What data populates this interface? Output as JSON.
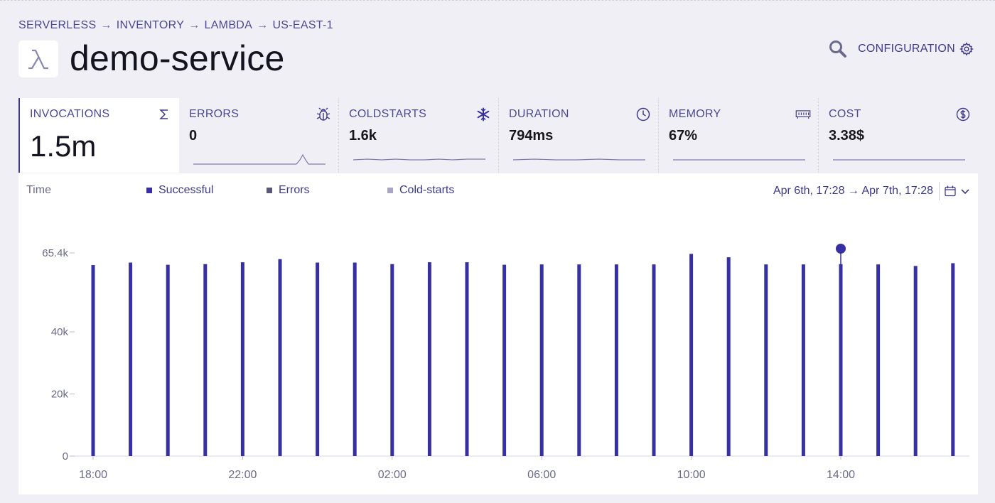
{
  "breadcrumb": [
    "SERVERLESS",
    "INVENTORY",
    "LAMBDA",
    "US-EAST-1"
  ],
  "breadcrumb_separator": "→",
  "title": "demo-service",
  "logo_icon": "lambda-icon",
  "actions": {
    "search_icon": "search-icon",
    "configuration_label": "CONFIGURATION",
    "configuration_icon": "gear-icon"
  },
  "metrics": [
    {
      "label": "INVOCATIONS",
      "value": "1.5m",
      "icon": "sigma-icon",
      "active": true
    },
    {
      "label": "ERRORS",
      "value": "0",
      "icon": "bug-icon"
    },
    {
      "label": "COLDSTARTS",
      "value": "1.6k",
      "icon": "snowflake-icon"
    },
    {
      "label": "DURATION",
      "value": "794ms",
      "icon": "clock-icon"
    },
    {
      "label": "MEMORY",
      "value": "67%",
      "icon": "memory-icon"
    },
    {
      "label": "COST",
      "value": "3.38$",
      "icon": "dollar-icon"
    }
  ],
  "legend": {
    "time_label": "Time",
    "items": [
      {
        "label": "Successful",
        "color": "#3730a3"
      },
      {
        "label": "Errors",
        "color": "#5b5a7a"
      },
      {
        "label": "Cold-starts",
        "color": "#a8a6c4"
      }
    ]
  },
  "date_range": {
    "label": "Apr 6th, 17:28 → Apr 7th, 17:28",
    "calendar_icon": "calendar-icon",
    "chevron_icon": "chevron-down-icon"
  },
  "colors": {
    "accent": "#3730a3",
    "text": "#3d3a8c",
    "title": "#141420",
    "background": "#f0eff5"
  },
  "chart_data": {
    "type": "bar",
    "categories": [
      "18:00",
      "19:00",
      "20:00",
      "21:00",
      "22:00",
      "23:00",
      "00:00",
      "01:00",
      "02:00",
      "03:00",
      "04:00",
      "05:00",
      "06:00",
      "07:00",
      "08:00",
      "09:00",
      "10:00",
      "11:00",
      "12:00",
      "13:00",
      "14:00",
      "15:00",
      "16:00",
      "17:00"
    ],
    "series": [
      {
        "name": "Successful",
        "values": [
          61500,
          62300,
          61600,
          61800,
          62400,
          63400,
          62300,
          62300,
          61800,
          62400,
          62400,
          61600,
          61700,
          61700,
          61700,
          61700,
          65100,
          64000,
          61700,
          61700,
          61800,
          61700,
          61200,
          62100
        ]
      },
      {
        "name": "Errors",
        "values": [
          0,
          0,
          0,
          0,
          0,
          0,
          0,
          0,
          0,
          0,
          0,
          0,
          0,
          0,
          0,
          0,
          0,
          0,
          0,
          0,
          0,
          0,
          0,
          0
        ]
      },
      {
        "name": "Cold-starts",
        "values": [
          0,
          0,
          0,
          0,
          0,
          0,
          0,
          0,
          0,
          0,
          0,
          0,
          0,
          0,
          0,
          0,
          0,
          0,
          0,
          0,
          0,
          0,
          0,
          0
        ]
      }
    ],
    "y_ticks": [
      {
        "value": 0,
        "label": "0"
      },
      {
        "value": 20000,
        "label": "20k"
      },
      {
        "value": 40000,
        "label": "40k"
      },
      {
        "value": 65400,
        "label": "65.4k"
      }
    ],
    "x_tick_labels": [
      "18:00",
      "22:00",
      "02:00",
      "06:00",
      "10:00",
      "14:00"
    ],
    "ylim": [
      0,
      65400
    ],
    "highlight_category": "14:00",
    "grid": false,
    "legend_position": "top"
  }
}
